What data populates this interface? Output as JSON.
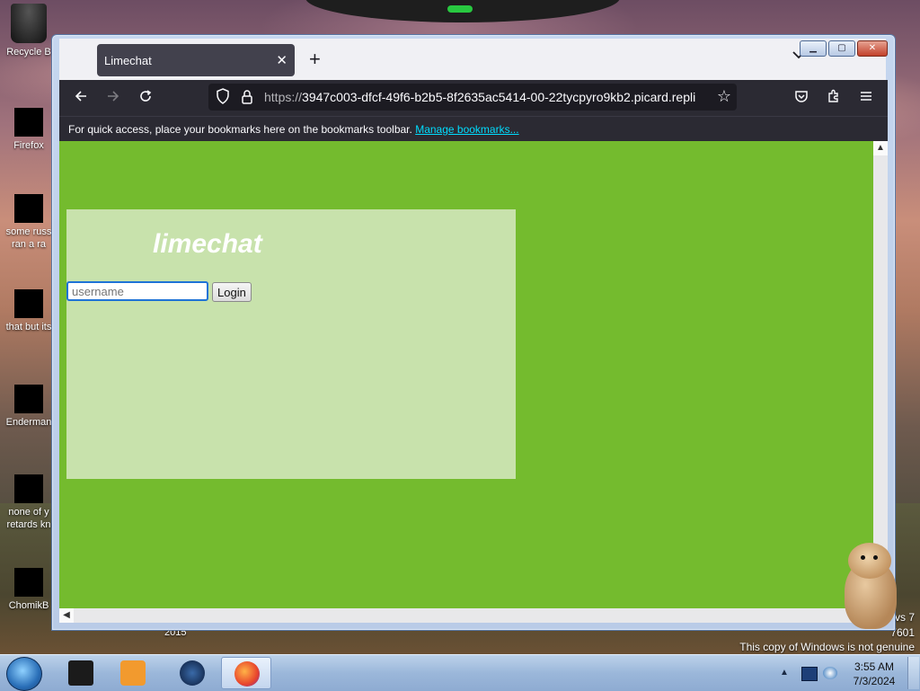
{
  "desktop": {
    "icons": [
      {
        "label": "Recycle B"
      },
      {
        "label": "Firefox"
      },
      {
        "label": "some russ ran a ra"
      },
      {
        "label": "that but its"
      },
      {
        "label": "Enderman"
      },
      {
        "label": "none of y retards kn"
      },
      {
        "label": "ChomikB"
      }
    ],
    "watermark": {
      "line1": "vs 7",
      "line2": "7601",
      "line3": "This copy of Windows is not genuine"
    },
    "year_label": "2015"
  },
  "browser": {
    "tab_title": "Limechat",
    "url_protocol": "https://",
    "url_rest": "3947c003-dfcf-49f6-b2b5-8f2635ac5414-00-22tycpyro9kb2.picard.repli",
    "bookmarks_text": "For quick access, place your bookmarks here on the bookmarks toolbar.",
    "bookmarks_link": "Manage bookmarks..."
  },
  "page": {
    "brand": "limechat",
    "username_placeholder": "username",
    "login_label": "Login"
  },
  "taskbar": {
    "time": "3:55 AM",
    "date": "7/3/2024"
  },
  "colors": {
    "page_bg": "#74bb2e",
    "card_bg": "#c8e2ac",
    "browser_chrome": "#2b2a33",
    "link": "#00ddff"
  }
}
